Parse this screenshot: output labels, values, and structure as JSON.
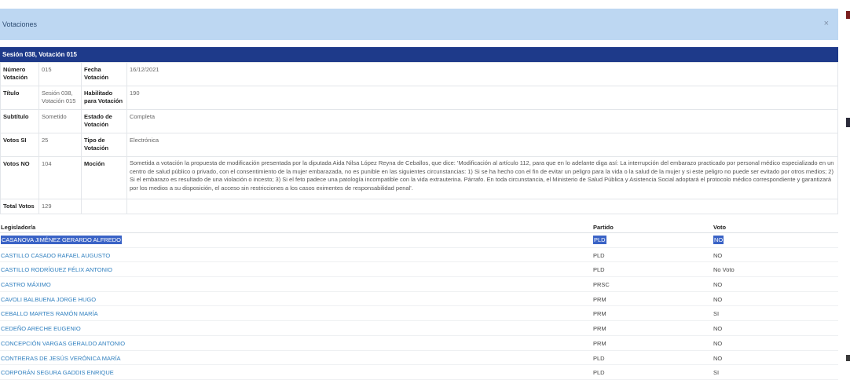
{
  "modal": {
    "title": "Votaciones",
    "close_glyph": "×"
  },
  "band": {
    "title": "Sesión 038, Votación 015"
  },
  "info": {
    "numero_label": "Número Votación",
    "numero_value": "015",
    "fecha_label": "Fecha Votación",
    "fecha_value": "16/12/2021",
    "titulo_label": "Título",
    "titulo_value": "Sesión 038, Votación 015",
    "habilitado_label": "Habilitado para Votación",
    "habilitado_value": "190",
    "subtitulo_label": "Subtítulo",
    "subtitulo_value": "Sometido",
    "estado_label": "Estado de Votación",
    "estado_value": "Completa",
    "votos_si_label": "Votos SI",
    "votos_si_value": "25",
    "tipo_label": "Tipo de Votación",
    "tipo_value": "Electrónica",
    "votos_no_label": "Votos NO",
    "votos_no_value": "104",
    "mocion_label": "Moción",
    "mocion_value": "Sometida a votación la propuesta de modificación presentada por la diputada Aida Nilsa López Reyna de Ceballos, que dice: 'Modificación al artículo 112, para que en lo adelante diga así: La interrupción del embarazo practicado por personal médico especializado en un centro de salud público o privado, con el consentimiento de la mujer embarazada, no es punible en las siguientes circunstancias: 1) Si se ha hecho con el fin de evitar un peligro para la vida o la salud de la mujer y si este peligro no puede ser evitado por otros medios; 2) Si el embarazo es resultado de una violación o incesto; 3) Si el feto padece una patología incompatible con la vida extrauterina. Párrafo. En toda circunstancia, el Ministerio de Salud Pública y Asistencia Social adoptará el protocolo médico correspondiente y garantizará por los medios a su disposición, el acceso sin restricciones a los casos eximentes de responsabilidad penal'.",
    "total_label": "Total Votos",
    "total_value": "129"
  },
  "legislators": {
    "col_name": "Legislador/a",
    "col_party": "Partido",
    "col_vote": "Voto",
    "rows": [
      {
        "name": "CASANOVA JIMÉNEZ GERARDO ALFREDO",
        "party": "PLD",
        "vote": "NO"
      },
      {
        "name": "CASTILLO CASADO RAFAEL AUGUSTO",
        "party": "PLD",
        "vote": "NO"
      },
      {
        "name": "CASTILLO RODRÍGUEZ FÉLIX ANTONIO",
        "party": "PLD",
        "vote": "No Voto"
      },
      {
        "name": "CASTRO MÁXIMO",
        "party": "PRSC",
        "vote": "NO"
      },
      {
        "name": "CAVOLI BALBUENA JORGE HUGO",
        "party": "PRM",
        "vote": "NO"
      },
      {
        "name": "CEBALLO MARTES RAMÓN MARÍA",
        "party": "PRM",
        "vote": "SI"
      },
      {
        "name": "CEDEÑO ARECHE EUGENIO",
        "party": "PRM",
        "vote": "NO"
      },
      {
        "name": "CONCEPCIÓN VARGAS GERALDO ANTONIO",
        "party": "PRM",
        "vote": "NO"
      },
      {
        "name": "CONTRERAS DE JESÚS VERÓNICA MARÍA",
        "party": "PLD",
        "vote": "NO"
      },
      {
        "name": "CORPORÁN SEGURA GADDIS ENRIQUE",
        "party": "PLD",
        "vote": "SI"
      }
    ]
  },
  "colors": {
    "header_bg": "#bdd7f2",
    "band_bg": "#1e3a8a",
    "link": "#2f7fbf",
    "selection": "#3a63c6"
  }
}
